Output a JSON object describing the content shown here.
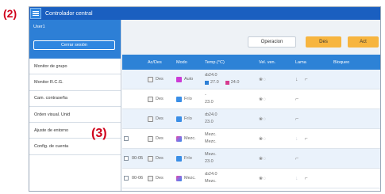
{
  "annotations": {
    "a2": "(2)",
    "a3": "(3)"
  },
  "app": {
    "title": "Controlador central"
  },
  "sidebar": {
    "user": "User1",
    "logout": "Cerrar sesión",
    "items": [
      "Monitor de grupo",
      "Monitor R.C.G.",
      "Cam. contraseña",
      "Orden visual. Unid",
      "Ajuste de entorno",
      "Config. de cuenta"
    ]
  },
  "toolbar": {
    "operation": "Operacion",
    "off": "Des",
    "on": "Act"
  },
  "table": {
    "headers": [
      "Ac/Des",
      "Modo",
      "Temp.(°C)",
      "Vel. ven.",
      "Lama",
      "Bloqueo"
    ],
    "rows": [
      {
        "id": "",
        "onoff": "Des",
        "mode": "Auto",
        "mode_icon": "auto",
        "t1": "24.0",
        "t2": "27.0",
        "t2b": "24.0"
      },
      {
        "id": "",
        "onoff": "Des",
        "mode": "Frío",
        "mode_icon": "cool",
        "t1": "-",
        "t2": "23.0",
        "t2b": ""
      },
      {
        "id": "",
        "onoff": "Des",
        "mode": "Frío",
        "mode_icon": "cool",
        "t1": "24.0",
        "t2": "23.0",
        "t2b": ""
      },
      {
        "id": "",
        "onoff": "Des",
        "mode": "Mezc.",
        "mode_icon": "mix",
        "t1": "Mezc.",
        "t2": "Mezc.",
        "t2b": ""
      },
      {
        "id": "00-05",
        "onoff": "Des",
        "mode": "Frío",
        "mode_icon": "cool",
        "t1": "Mezc.",
        "t2": "23.0",
        "t2b": ""
      },
      {
        "id": "00-06",
        "onoff": "Des",
        "mode": "Mezc.",
        "mode_icon": "mix",
        "t1": "24.0",
        "t2": "Mezc.",
        "t2b": ""
      }
    ]
  }
}
